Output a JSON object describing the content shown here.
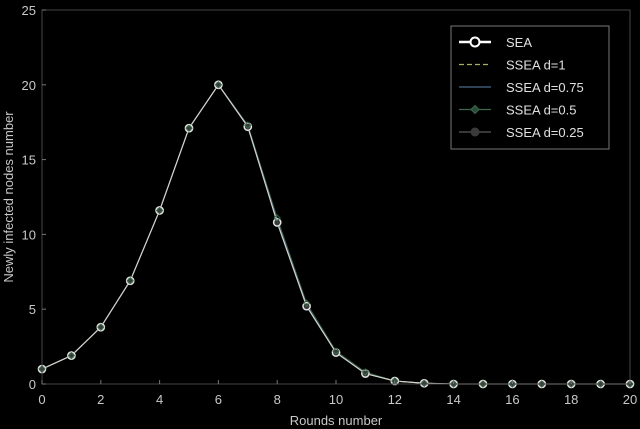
{
  "chart_data": {
    "type": "line",
    "xlabel": "Rounds number",
    "ylabel": "Newly  infected nodes number",
    "xlim": [
      0,
      20
    ],
    "ylim": [
      0,
      25
    ],
    "xticks": [
      "0",
      "2",
      "4",
      "6",
      "8",
      "10",
      "12",
      "14",
      "16",
      "18",
      "20"
    ],
    "yticks": [
      "0",
      "5",
      "10",
      "15",
      "20",
      "25"
    ],
    "grid": false,
    "legend_position": "top-right",
    "x": [
      0,
      1,
      2,
      3,
      4,
      5,
      6,
      7,
      8,
      9,
      10,
      11,
      12,
      13,
      14,
      15,
      16,
      17,
      18,
      19,
      20
    ],
    "series": [
      {
        "name": "SEA",
        "color": "#ffffff",
        "marker": "circle",
        "values": [
          1,
          1.9,
          3.8,
          6.9,
          11.6,
          17.1,
          20,
          17.2,
          10.8,
          5.2,
          2.1,
          0.7,
          0.2,
          0.05,
          0,
          0,
          0,
          0,
          0,
          0,
          0
        ]
      },
      {
        "name": "SSEA d=1",
        "color": "#a8b060",
        "marker": "none",
        "values": [
          1,
          1.9,
          3.8,
          6.9,
          11.6,
          17.1,
          20,
          17.2,
          10.8,
          5.2,
          2.1,
          0.7,
          0.2,
          0.05,
          0,
          0,
          0,
          0,
          0,
          0,
          0
        ]
      },
      {
        "name": "SSEA d=0.75",
        "color": "#4a6a8a",
        "marker": "none",
        "values": [
          1,
          1.9,
          3.8,
          6.9,
          11.6,
          17.1,
          20,
          17.3,
          11.0,
          5.3,
          2.1,
          0.7,
          0.2,
          0.05,
          0,
          0,
          0,
          0,
          0,
          0,
          0
        ]
      },
      {
        "name": "SSEA d=0.5",
        "color": "#3a6a4a",
        "marker": "diamond",
        "values": [
          1,
          1.9,
          3.8,
          6.9,
          11.6,
          17.1,
          20,
          17.3,
          11.1,
          5.4,
          2.2,
          0.8,
          0.2,
          0.05,
          0,
          0,
          0,
          0,
          0,
          0,
          0
        ]
      },
      {
        "name": "SSEA d=0.25",
        "color": "#5a5a5a",
        "marker": "circle-filled",
        "values": [
          1,
          1.9,
          3.8,
          6.9,
          11.6,
          17.1,
          20,
          17.2,
          10.8,
          5.2,
          2.1,
          0.7,
          0.2,
          0.05,
          0,
          0,
          0,
          0,
          0,
          0,
          0
        ]
      }
    ]
  }
}
